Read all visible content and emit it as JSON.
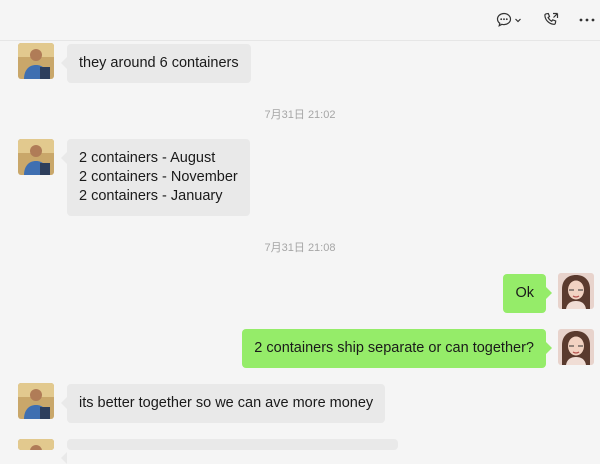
{
  "toolbar": {
    "chat_icon": "chat-bubble-icon",
    "call_icon": "phone-icon",
    "more_icon": "more-icon"
  },
  "colors": {
    "incoming_bubble": "#e9e9e9",
    "outgoing_bubble": "#95ec69",
    "background": "#f5f5f5"
  },
  "messages": [
    {
      "side": "in",
      "lines": [
        "they around 6 containers"
      ]
    },
    {
      "timestamp": "7月31日 21:02"
    },
    {
      "side": "in",
      "lines": [
        "2 containers - August",
        "2 containers - November",
        "2 containers - January"
      ]
    },
    {
      "timestamp": "7月31日 21:08"
    },
    {
      "side": "out",
      "lines": [
        "Ok"
      ]
    },
    {
      "side": "out",
      "lines": [
        "2 containers ship separate or can together?"
      ]
    },
    {
      "side": "in",
      "lines": [
        "its better together so we can ave more money"
      ]
    }
  ]
}
